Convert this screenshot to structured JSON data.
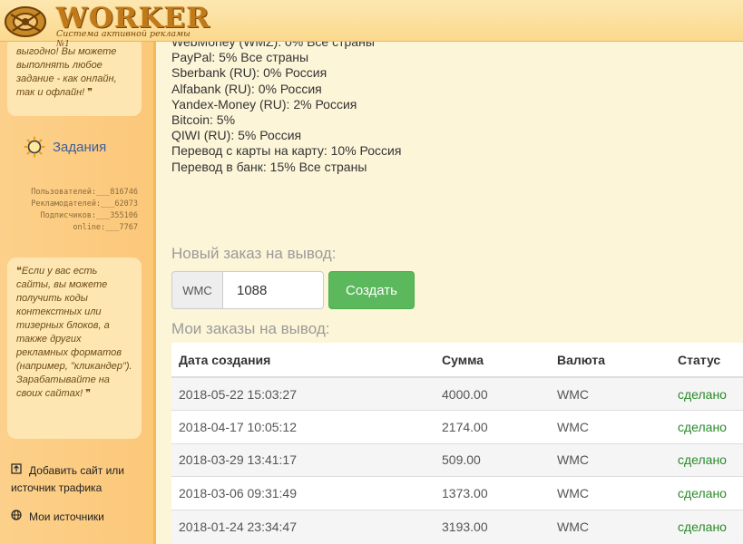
{
  "header": {
    "logo_text": "WORKER",
    "logo_subtitle": "Система активной рекламы №1"
  },
  "sidebar": {
    "bubble_top": "выгодно! Вы можете выполнять любое задание - как онлайн, так и офлайн! ❞",
    "tasks_label": "Задания",
    "stats": [
      "Пользователей:___816746",
      "Рекламодателей:___62073",
      "Подписчиков:___355106",
      "online:___7767"
    ],
    "bubble_bottom": "❝Если у вас есть сайты, вы можете получить коды контекстных или тизерных блоков, а также других рекламных форматов (например, \"кликандер\"). Зарабатывайте на своих сайтах! ❞",
    "links": [
      {
        "label": "Добавить сайт или источник трафика",
        "icon": "upload-icon"
      },
      {
        "label": "Мои источники",
        "icon": "globe-icon"
      }
    ]
  },
  "withdraw_methods": [
    "WebMoney (WMZ): 0% Все страны",
    "PayPal: 5% Все страны",
    "Sberbank (RU): 0% Россия",
    "Alfabank (RU): 0% Россия",
    "Yandex-Money (RU): 2% Россия",
    "Bitcoin: 5%",
    "QIWI (RU): 5% Россия",
    "Перевод с карты на карту: 10% Россия",
    "Перевод в банк: 15% Все страны"
  ],
  "new_order": {
    "title": "Новый заказ на вывод:",
    "currency": "WMC",
    "amount": "1088",
    "button_label": "Создать"
  },
  "orders": {
    "title": "Мои заказы на вывод:",
    "columns": [
      "Дата создания",
      "Сумма",
      "Валюта",
      "Статус"
    ],
    "rows": [
      [
        "2018-05-22 15:03:27",
        "4000.00",
        "WMC",
        "сделано"
      ],
      [
        "2018-04-17 10:05:12",
        "2174.00",
        "WMC",
        "сделано"
      ],
      [
        "2018-03-29 13:41:17",
        "509.00",
        "WMC",
        "сделано"
      ],
      [
        "2018-03-06 09:31:49",
        "1373.00",
        "WMC",
        "сделано"
      ],
      [
        "2018-01-24 23:34:47",
        "3193.00",
        "WMC",
        "сделано"
      ]
    ]
  },
  "colors": {
    "sidebar_bg": "#fcc87a",
    "page_bg": "#fdf5d8",
    "button_green": "#5cb85c",
    "status_done": "#2a8a2a",
    "tasks_link": "#3d5d9a"
  }
}
